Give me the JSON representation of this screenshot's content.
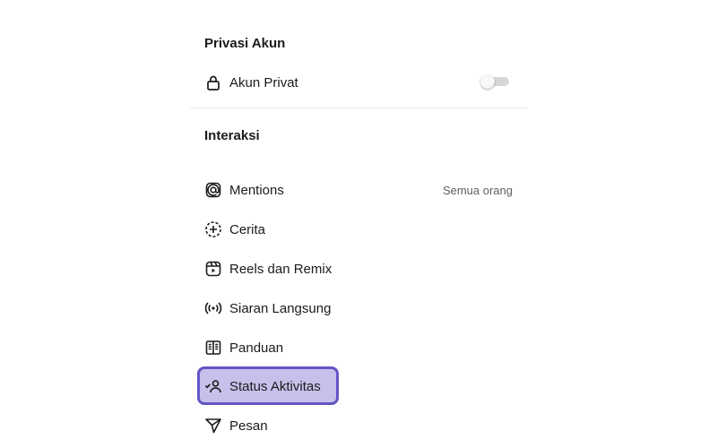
{
  "privacy": {
    "title": "Privasi Akun",
    "private_account": {
      "label": "Akun Privat",
      "icon": "lock-icon",
      "toggle_on": false
    }
  },
  "interactions": {
    "title": "Interaksi",
    "items": [
      {
        "label": "Mentions",
        "icon": "at-sign-icon",
        "value": "Semua orang"
      },
      {
        "label": "Cerita",
        "icon": "story-add-icon"
      },
      {
        "label": "Reels dan Remix",
        "icon": "reels-icon"
      },
      {
        "label": "Siaran Langsung",
        "icon": "live-broadcast-icon"
      },
      {
        "label": "Panduan",
        "icon": "guide-book-icon"
      },
      {
        "label": "Status Aktivitas",
        "icon": "activity-status-icon",
        "highlighted": true
      },
      {
        "label": "Pesan",
        "icon": "send-message-icon"
      }
    ]
  },
  "colors": {
    "highlight_fill": "#c6c0ea",
    "highlight_border": "#6356c7",
    "toggle_track": "#d7d7d7"
  }
}
